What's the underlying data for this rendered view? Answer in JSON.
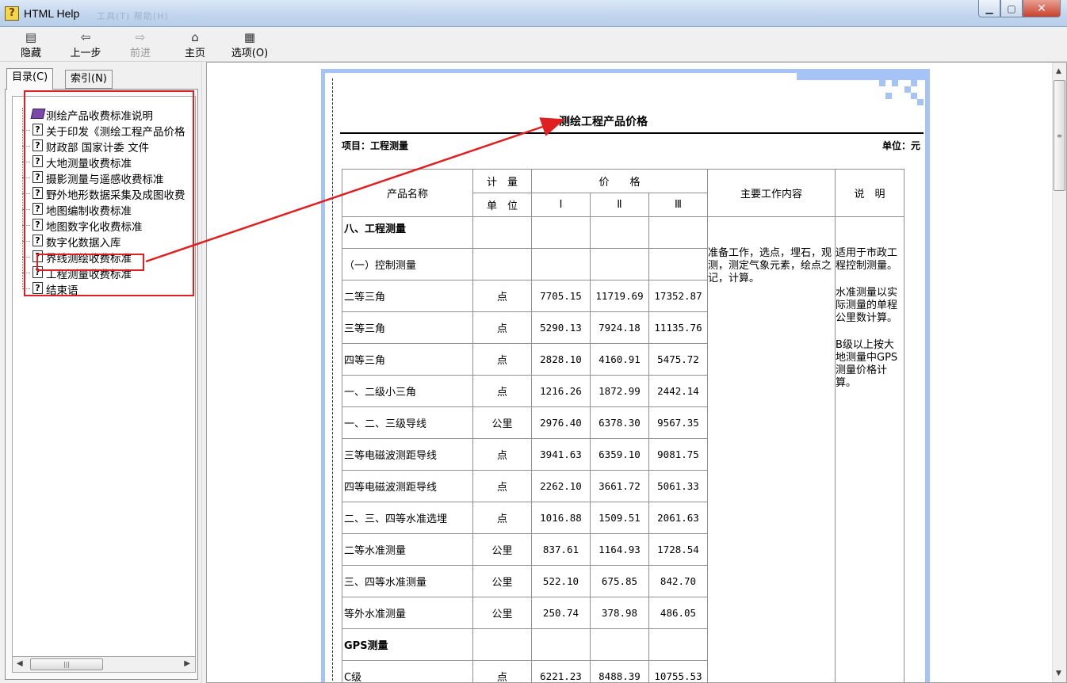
{
  "window": {
    "title": "HTML Help",
    "ghost_menu": "工具(T)    帮助(H)"
  },
  "toolbar": {
    "hide": "隐藏",
    "back": "上一步",
    "forward": "前进",
    "home": "主页",
    "options": "选项(O)"
  },
  "tabs": {
    "contents": "目录(C)",
    "index": "索引(N)"
  },
  "tree": {
    "root": "测绘产品收费标准说明",
    "items": [
      "关于印发《测绘工程产品价格",
      "财政部 国家计委 文件",
      "大地测量收费标准",
      "摄影测量与遥感收费标准",
      "野外地形数据采集及成图收费",
      "地图编制收费标准",
      "地图数字化收费标准",
      "数字化数据入库",
      "界线测绘收费标准",
      "工程测量收费标准",
      "结束语"
    ]
  },
  "doc": {
    "title": "测绘工程产品价格",
    "project": "项目：工程测量",
    "unit": "单位：元",
    "headers": {
      "name": "产品名称",
      "unit_top": "计　量",
      "unit_bottom": "单　位",
      "price": "价　　格",
      "p1": "Ⅰ",
      "p2": "Ⅱ",
      "p3": "Ⅲ",
      "work": "主要工作内容",
      "note": "说　明"
    },
    "section": "八、工程测量",
    "subsection": "（一）控制测量",
    "work_content": "准备工作，选点，埋石，观测，测定气象元素，绘点之记，计算。",
    "notes": [
      "适用于市政工程控制测量。",
      "水准测量以实际测量的单程公里数计算。",
      "B级以上按大地测量中GPS测量价格计算。"
    ],
    "rows": [
      {
        "name": "二等三角",
        "unit": "点",
        "p1": "7705.15",
        "p2": "11719.69",
        "p3": "17352.87"
      },
      {
        "name": "三等三角",
        "unit": "点",
        "p1": "5290.13",
        "p2": "7924.18",
        "p3": "11135.76"
      },
      {
        "name": "四等三角",
        "unit": "点",
        "p1": "2828.10",
        "p2": "4160.91",
        "p3": "5475.72"
      },
      {
        "name": "一、二级小三角",
        "unit": "点",
        "p1": "1216.26",
        "p2": "1872.99",
        "p3": "2442.14"
      },
      {
        "name": "一、二、三级导线",
        "unit": "公里",
        "p1": "2976.40",
        "p2": "6378.30",
        "p3": "9567.35"
      },
      {
        "name": "三等电磁波测距导线",
        "unit": "点",
        "p1": "3941.63",
        "p2": "6359.10",
        "p3": "9081.75"
      },
      {
        "name": "四等电磁波测距导线",
        "unit": "点",
        "p1": "2262.10",
        "p2": "3661.72",
        "p3": "5061.33"
      },
      {
        "name": "二、三、四等水准选埋",
        "unit": "点",
        "p1": "1016.88",
        "p2": "1509.51",
        "p3": "2061.63"
      },
      {
        "name": "二等水准测量",
        "unit": "公里",
        "p1": "837.61",
        "p2": "1164.93",
        "p3": "1728.54"
      },
      {
        "name": "三、四等水准测量",
        "unit": "公里",
        "p1": "522.10",
        "p2": "675.85",
        "p3": "842.70"
      },
      {
        "name": "等外水准测量",
        "unit": "公里",
        "p1": "250.74",
        "p2": "378.98",
        "p3": "486.05"
      }
    ],
    "gps_section": "GPS测量",
    "gps_row": {
      "name": "C级",
      "unit": "点",
      "p1": "6221.23",
      "p2": "8488.39",
      "p3": "10755.53"
    }
  },
  "colors": {
    "accent_blue": "#a5c3f7",
    "annotation_red": "#e02020"
  }
}
